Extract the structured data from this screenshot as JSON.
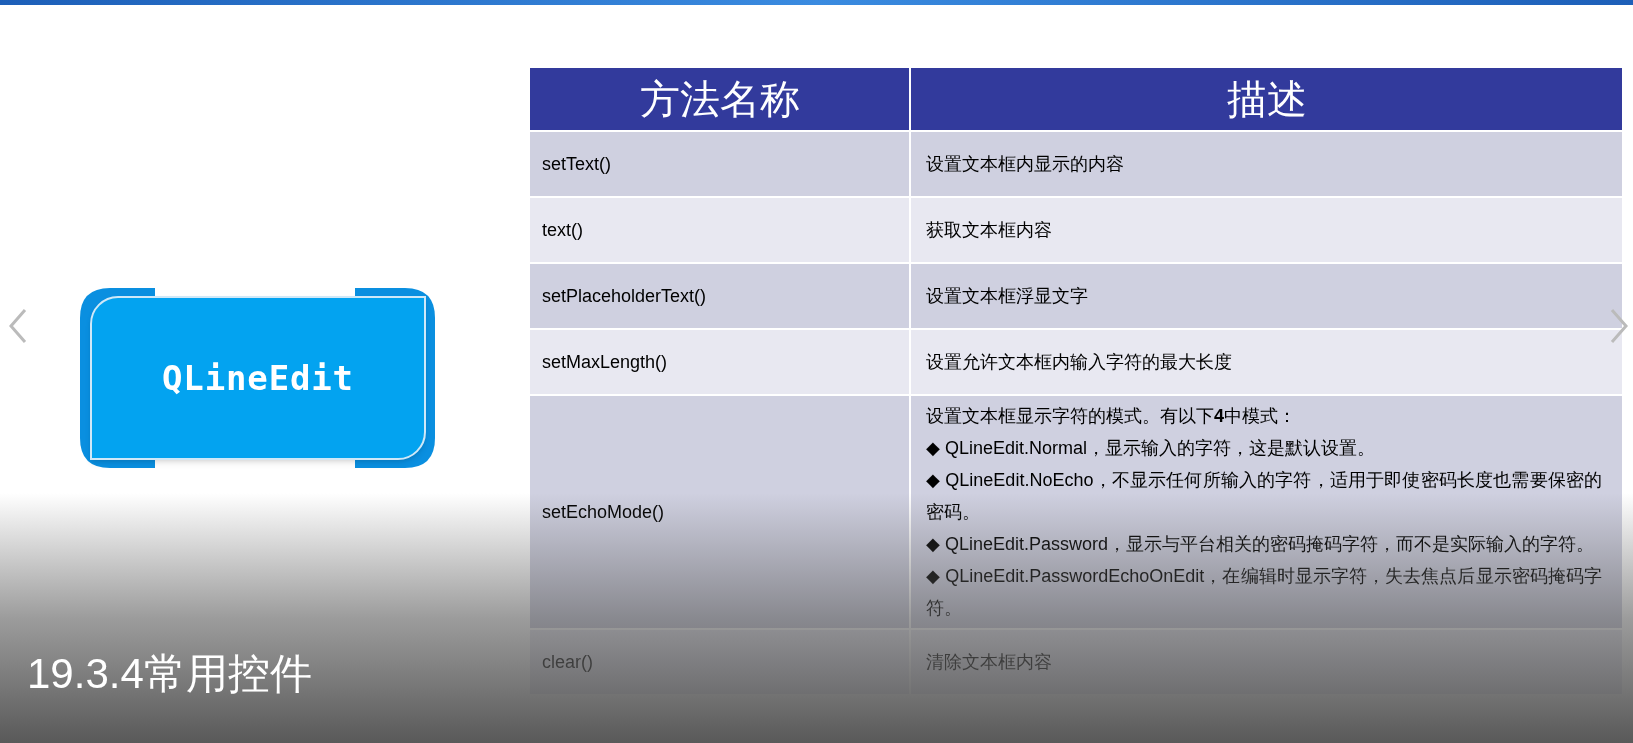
{
  "logo": {
    "label": "QLineEdit"
  },
  "table": {
    "columns": [
      "方法名称",
      "描述"
    ],
    "rows": [
      {
        "method": "setText()",
        "description": [
          "设置文本框内显示的内容"
        ]
      },
      {
        "method": "text()",
        "description": [
          "获取文本框内容"
        ]
      },
      {
        "method": "setPlaceholderText()",
        "description": [
          "设置文本框浮显文字"
        ]
      },
      {
        "method": "setMaxLength()",
        "description": [
          "设置允许文本框内输入字符的最大长度"
        ]
      },
      {
        "method": "setEchoMode()",
        "description": [
          "设置文本框显示字符的模式。有以下**4**中模式：",
          "◆ QLineEdit.Normal，显示输入的字符，这是默认设置。",
          "◆  QLineEdit.NoEcho，不显示任何所输入的字符，适用于即使密码长度也需要保密的密码。",
          "◆ QLineEdit.Password，显示与平台相关的密码掩码字符，而不是实际输入的字符。",
          "◆  QLineEdit.PasswordEchoOnEdit，在编辑时显示字符，失去焦点后显示密码掩码字符。"
        ]
      },
      {
        "method": "clear()",
        "description": [
          "清除文本框内容"
        ]
      }
    ]
  },
  "section_title": "19.3.4常用控件"
}
